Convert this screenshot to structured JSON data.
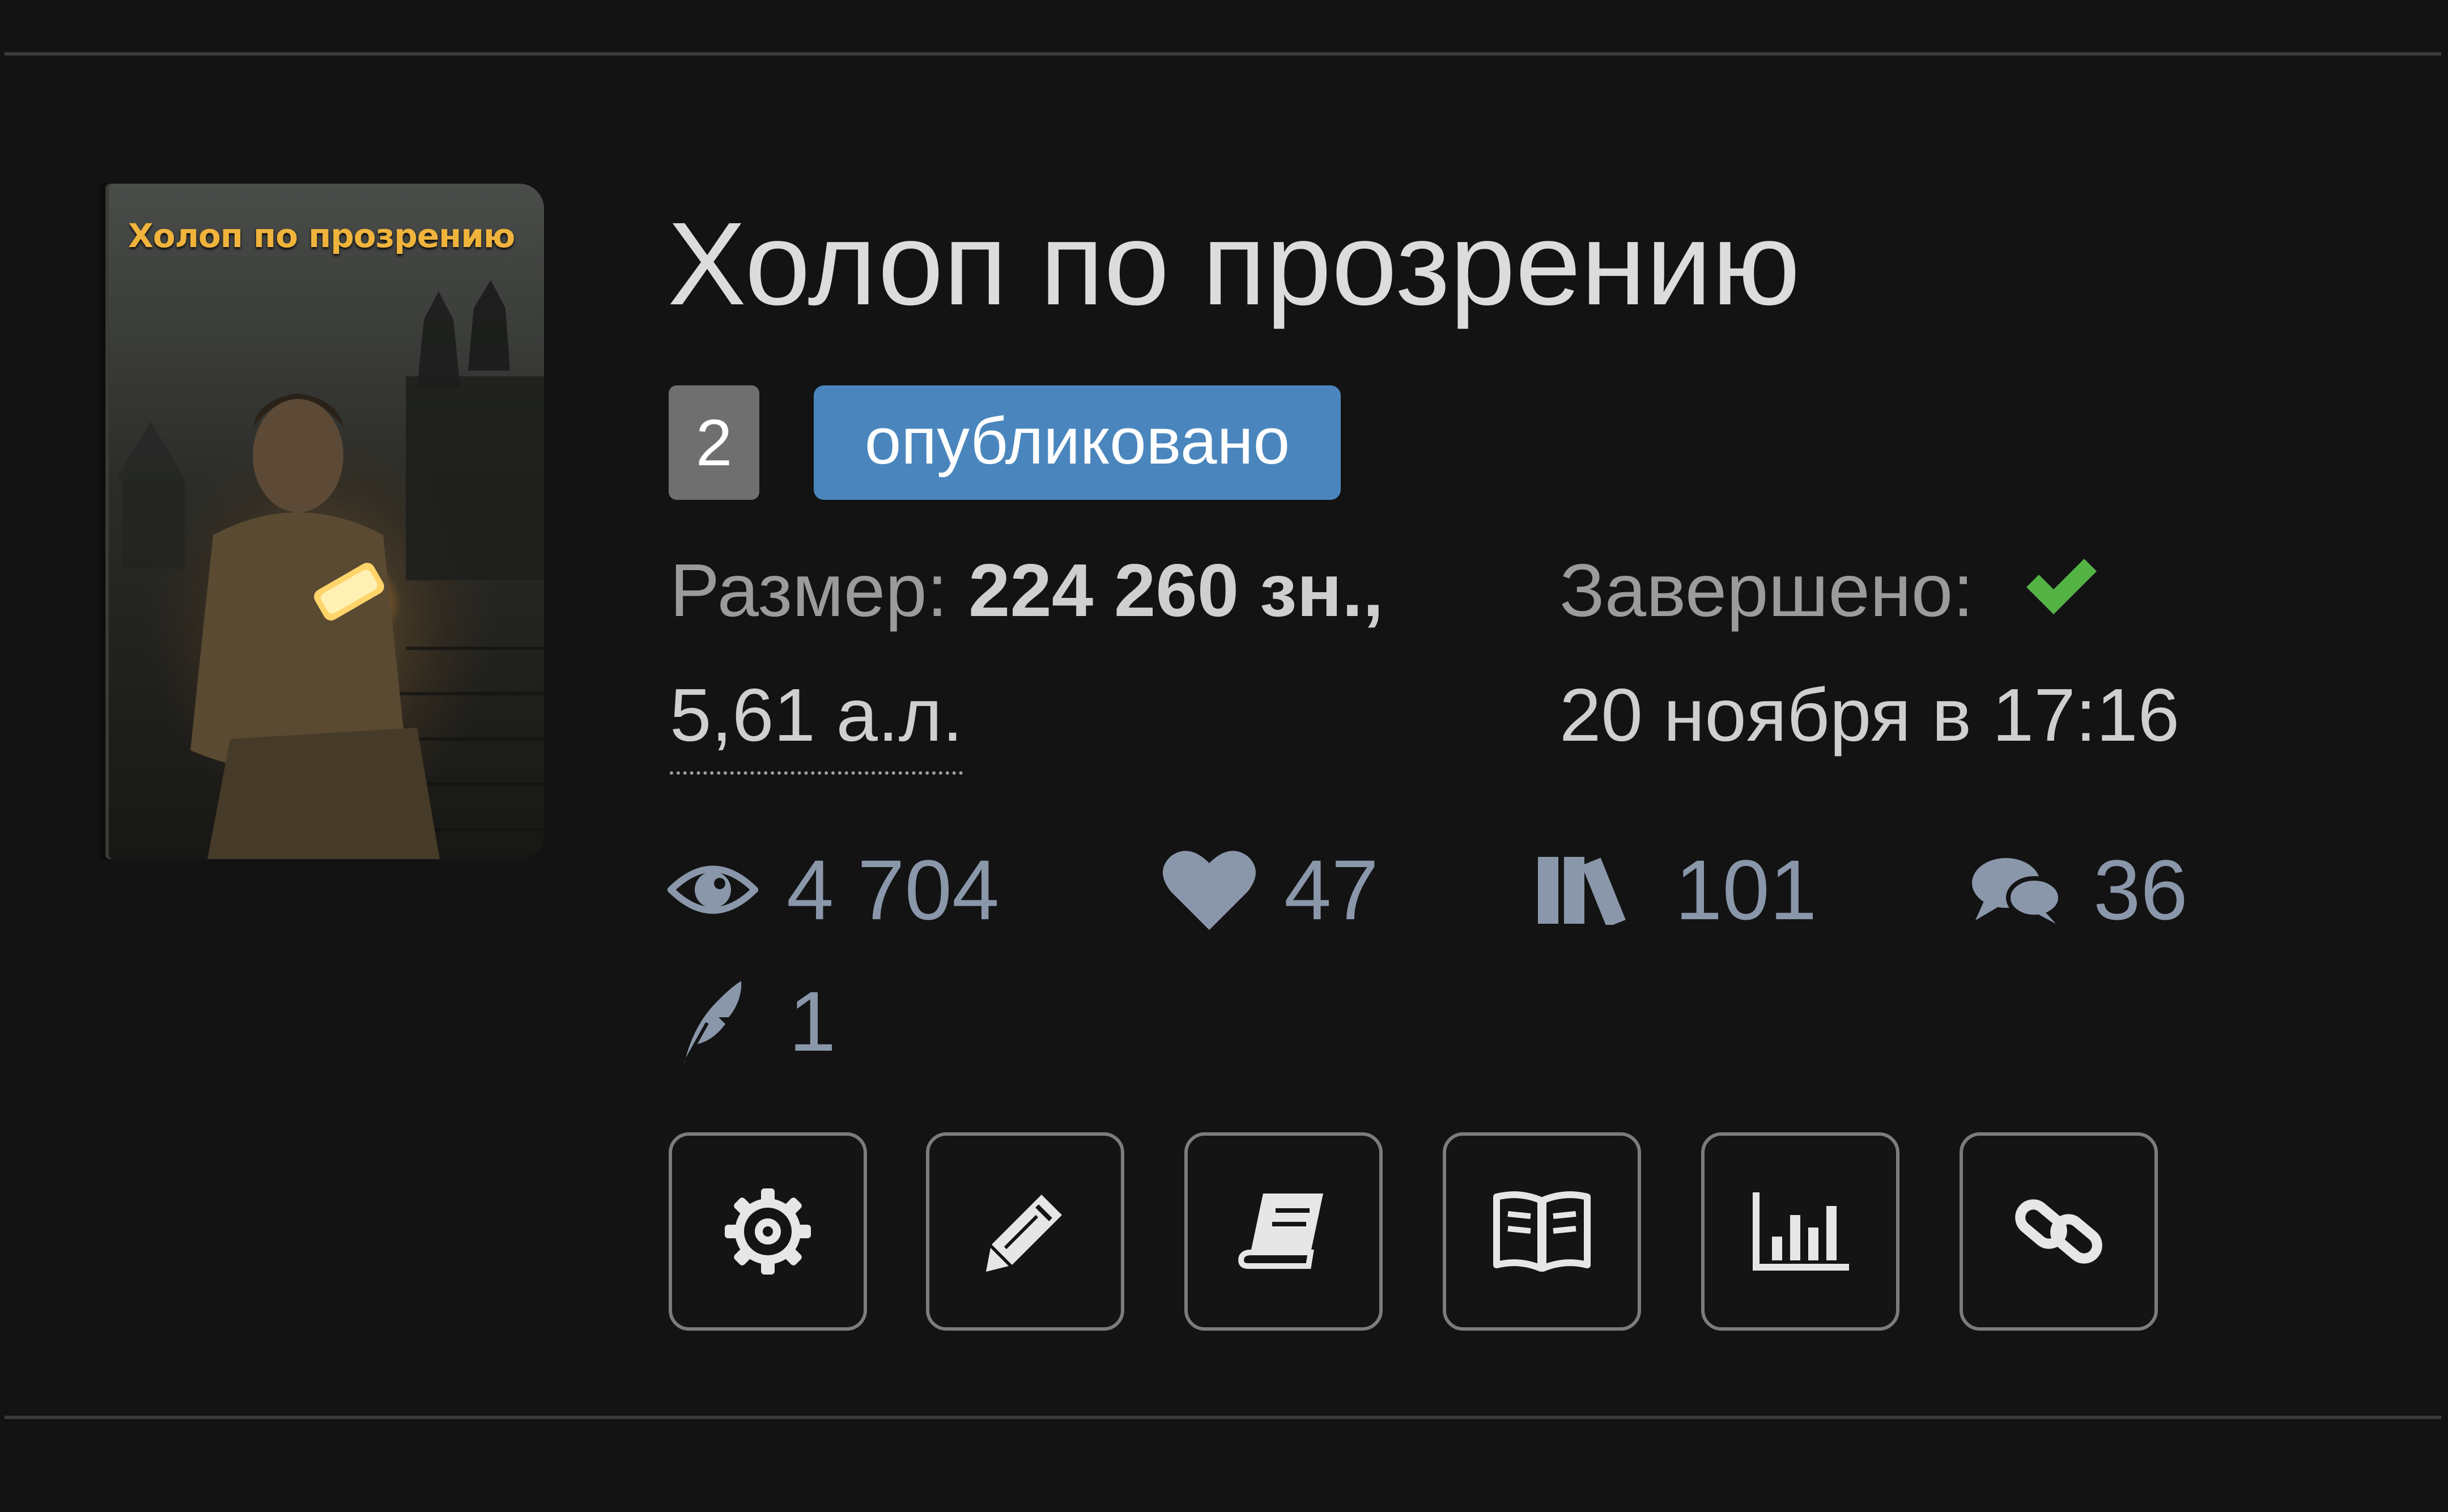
{
  "book": {
    "cover_title": "Холоп по прозрению",
    "title": "Холоп по прозрению",
    "number_badge": "2",
    "status_badge": "опубликовано",
    "size_label": "Размер:",
    "size_chars": "224 260 зн.,",
    "size_sheets": "5,61 а.л.",
    "completed_label": "Завершено:",
    "completed_date": "20 ноября в 17:16"
  },
  "stats": {
    "views": "4 704",
    "likes": "47",
    "libraries": "101",
    "comments": "36",
    "rewards": "1"
  },
  "icons": {
    "views": "eye-icon",
    "likes": "heart-icon",
    "libraries": "books-icon",
    "comments": "comments-icon",
    "rewards": "feather-icon",
    "completed": "check-icon"
  },
  "actions": [
    {
      "name": "settings",
      "icon": "gear-icon"
    },
    {
      "name": "edit",
      "icon": "pencil-icon"
    },
    {
      "name": "book",
      "icon": "book-icon"
    },
    {
      "name": "read",
      "icon": "open-book-icon"
    },
    {
      "name": "statistics",
      "icon": "bar-chart-icon"
    },
    {
      "name": "link",
      "icon": "link-icon"
    }
  ],
  "colors": {
    "background": "#131314",
    "status_badge": "#4a86bd",
    "number_badge": "#6f6f6f",
    "check": "#55b346",
    "stat": "#8a97aa"
  }
}
